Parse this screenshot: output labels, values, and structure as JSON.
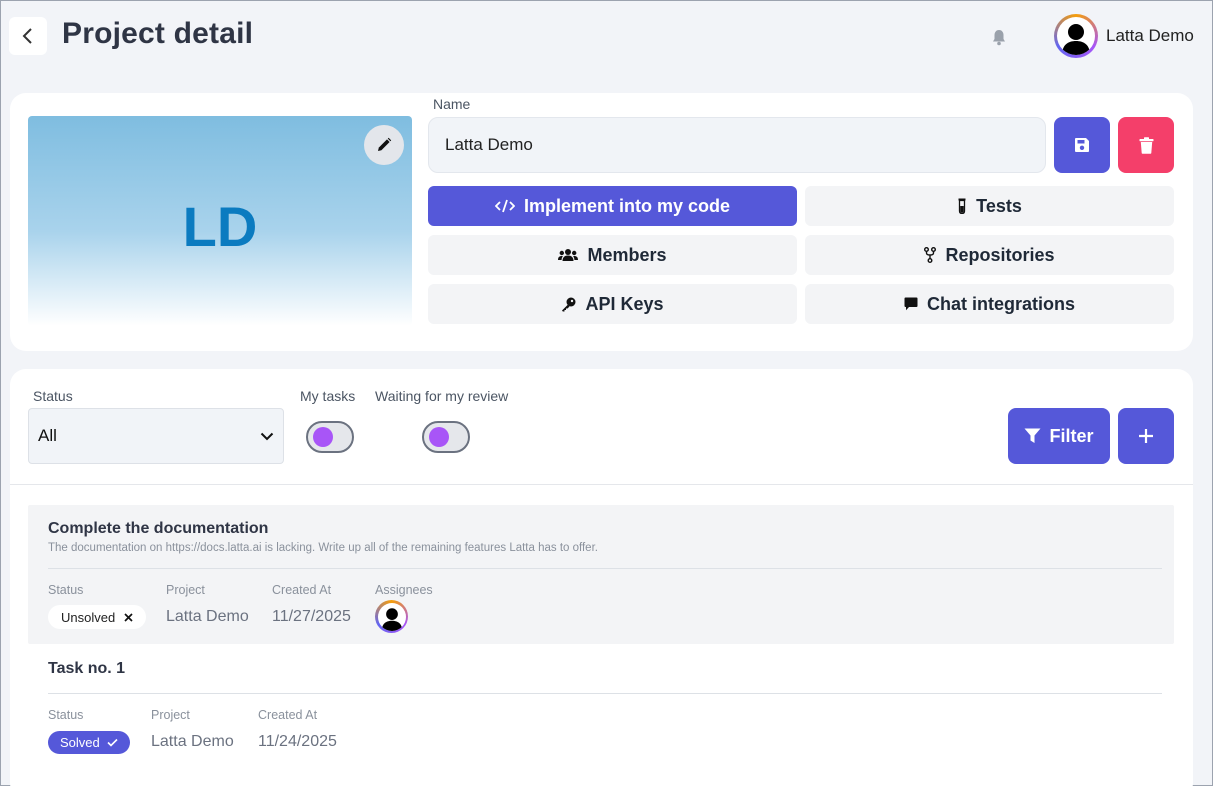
{
  "header": {
    "title": "Project detail",
    "user_name": "Latta Demo"
  },
  "project": {
    "initials": "LD",
    "name_label": "Name",
    "name_value": "Latta Demo",
    "actions": [
      {
        "label": "Implement into my code",
        "icon": "code-icon",
        "primary": true
      },
      {
        "label": "Tests",
        "icon": "flask-icon"
      },
      {
        "label": "Members",
        "icon": "users-icon"
      },
      {
        "label": "Repositories",
        "icon": "branch-icon"
      },
      {
        "label": "API Keys",
        "icon": "key-icon"
      },
      {
        "label": "Chat integrations",
        "icon": "chat-icon"
      }
    ]
  },
  "filters": {
    "status_label": "Status",
    "status_value": "All",
    "my_tasks_label": "My tasks",
    "waiting_label": "Waiting for my review",
    "filter_label": "Filter",
    "toggles": {
      "my_tasks": false,
      "waiting_review": false
    }
  },
  "tasks": [
    {
      "title": "Complete the documentation",
      "description": "The documentation on https://docs.latta.ai is lacking. Write up all of the remaining features Latta has to offer.",
      "status_label": "Status",
      "status": "Unsolved",
      "project_label": "Project",
      "project": "Latta Demo",
      "created_label": "Created At",
      "created": "11/27/2025",
      "assignees_label": "Assignees"
    },
    {
      "title": "Task no. 1",
      "status_label": "Status",
      "status": "Solved",
      "project_label": "Project",
      "project": "Latta Demo",
      "created_label": "Created At",
      "created": "11/24/2025"
    }
  ],
  "colors": {
    "primary": "#5558d9",
    "danger": "#f43f6a",
    "toggle_knob": "#a855f7",
    "initials": "#0b7bc0"
  }
}
